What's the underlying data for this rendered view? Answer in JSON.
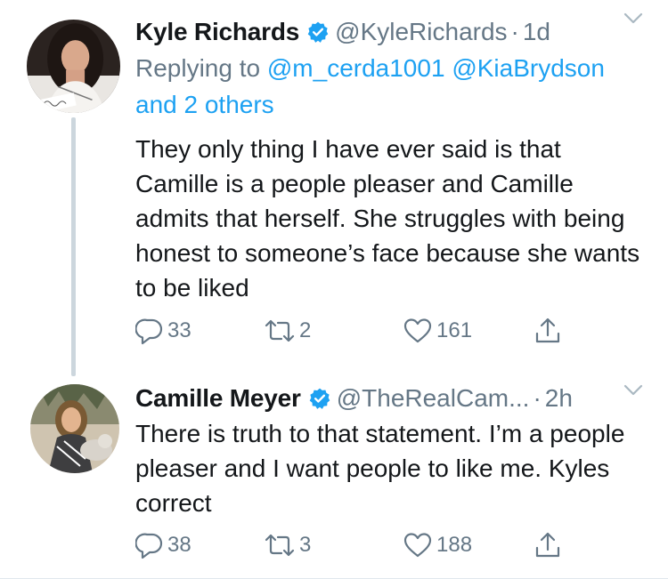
{
  "tweets": [
    {
      "name": "Kyle Richards",
      "handle": "@KyleRichards",
      "separator": "·",
      "time": "1d",
      "reply_prefix": "Replying to",
      "reply_users": [
        "@m_cerda1001",
        "@KiaBrydson"
      ],
      "reply_suffix": "and 2 others",
      "text": "They only thing I have ever said is that Camille is a people pleaser and Camille admits that herself. She struggles with being honest to someone’s face because she wants to be liked",
      "replies": "33",
      "retweets": "2",
      "likes": "161"
    },
    {
      "name": "Camille Meyer",
      "handle": "@TheRealCam...",
      "separator": "·",
      "time": "2h",
      "text": "There is truth to that statement. I’m a people pleaser and I want people to like me. Kyles correct",
      "replies": "38",
      "retweets": "3",
      "likes": "188"
    }
  ],
  "icons": {
    "verified": "verified-badge-icon",
    "reply": "speech-bubble-icon",
    "retweet": "retweet-arrows-icon",
    "like": "heart-icon",
    "share": "share-up-arrow-icon",
    "more": "chevron-down-icon"
  },
  "colors": {
    "accent": "#1da1f2",
    "secondary_text": "#657786",
    "primary_text": "#14171a",
    "thread_line": "#ccd6dd"
  }
}
